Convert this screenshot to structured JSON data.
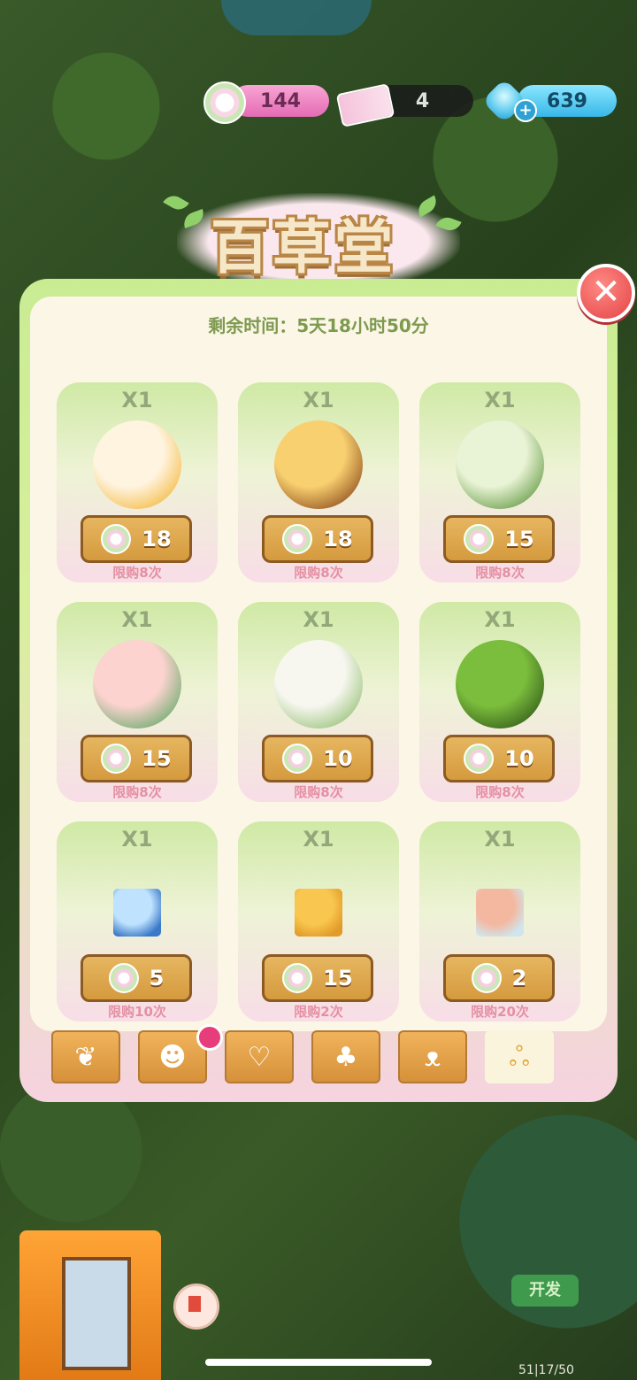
{
  "hud": {
    "leaf_coins": "144",
    "tickets": "4",
    "gems": "639",
    "gem_plus": "+"
  },
  "title": "百草堂",
  "timer": "剩余时间：5天18小时50分",
  "close_label": "✕",
  "items": [
    {
      "qty": "X1",
      "price": "18",
      "limit": "限购8次",
      "art": "fox-girl-pet"
    },
    {
      "qty": "X1",
      "price": "18",
      "limit": "限购8次",
      "art": "chick-in-box-pet"
    },
    {
      "qty": "X1",
      "price": "15",
      "limit": "限购8次",
      "art": "cabbage-sprite-pet"
    },
    {
      "qty": "X1",
      "price": "15",
      "limit": "限购8次",
      "art": "peach-bug-pet"
    },
    {
      "qty": "X1",
      "price": "10",
      "limit": "限购8次",
      "art": "onion-sprite-pet"
    },
    {
      "qty": "X1",
      "price": "10",
      "limit": "限购8次",
      "art": "leaf-beetle-pet"
    },
    {
      "qty": "X1",
      "price": "5",
      "limit": "限购10次",
      "art": "ticket-item"
    },
    {
      "qty": "X1",
      "price": "15",
      "limit": "限购2次",
      "art": "cheese-block-item"
    },
    {
      "qty": "X1",
      "price": "2",
      "limit": "限购20次",
      "art": "flower-vase-item"
    }
  ],
  "tabs": [
    {
      "icon": "leaf-branch-icon",
      "glyph": "❦"
    },
    {
      "icon": "pets-face-icon",
      "glyph": "☻"
    },
    {
      "icon": "basket-heart-icon",
      "glyph": "♡"
    },
    {
      "icon": "tree-icon",
      "glyph": "♣"
    },
    {
      "icon": "cat-face-icon",
      "glyph": "ᴥ"
    },
    {
      "icon": "seed-bag-icon",
      "glyph": "ஃ"
    }
  ],
  "dev_button": "开发",
  "coords": "51|17/50"
}
